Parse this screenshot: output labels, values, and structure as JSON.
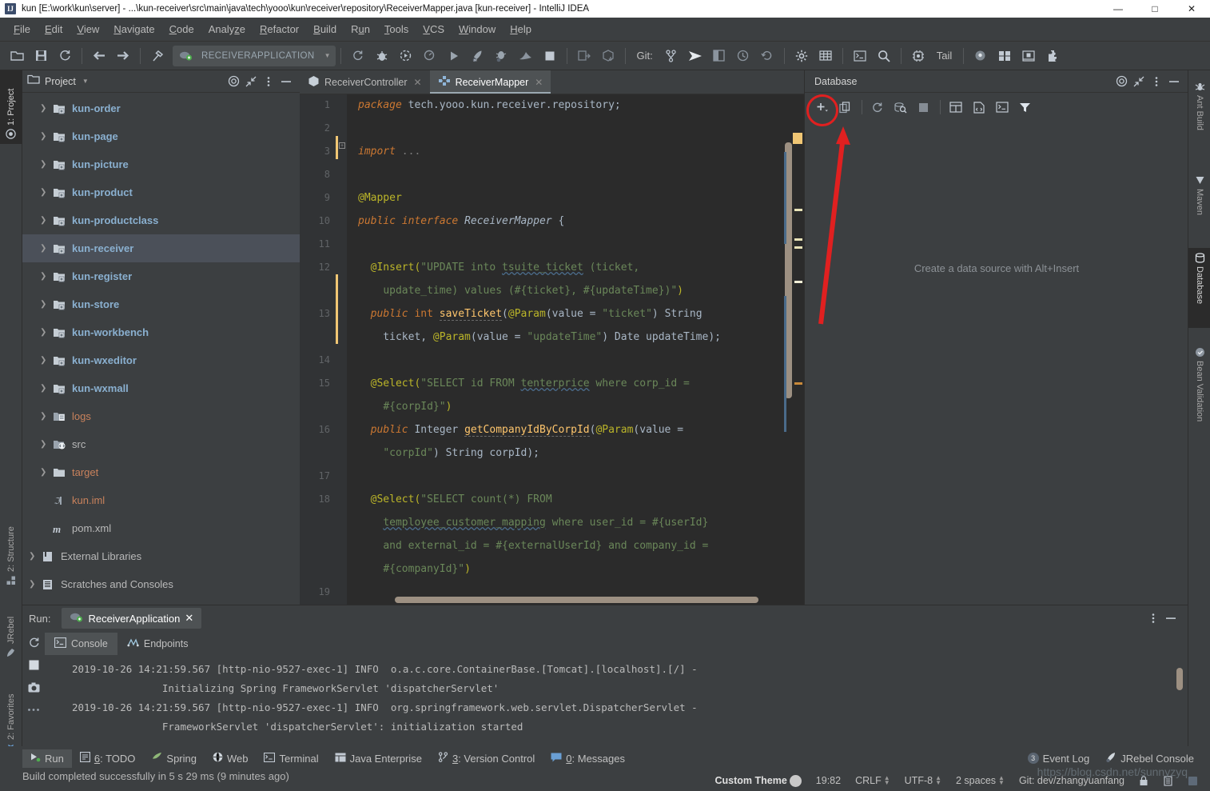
{
  "window": {
    "title": "kun [E:\\work\\kun\\server] - ...\\kun-receiver\\src\\main\\java\\tech\\yooo\\kun\\receiver\\repository\\ReceiverMapper.java [kun-receiver] - IntelliJ IDEA",
    "minimize": "—",
    "maximize": "□",
    "close": "✕"
  },
  "menu": [
    {
      "label": "File"
    },
    {
      "label": "Edit"
    },
    {
      "label": "View"
    },
    {
      "label": "Navigate"
    },
    {
      "label": "Code"
    },
    {
      "label": "Analyze"
    },
    {
      "label": "Refactor"
    },
    {
      "label": "Build"
    },
    {
      "label": "Run"
    },
    {
      "label": "Tools"
    },
    {
      "label": "VCS"
    },
    {
      "label": "Window"
    },
    {
      "label": "Help"
    }
  ],
  "toolbar": {
    "run_configuration": "RECEIVERAPPLICATION",
    "git_label": "Git:",
    "tail_label": "Tail",
    "icons": [
      "open-folder-icon",
      "save-all-icon",
      "sync-icon",
      "back-icon",
      "forward-icon",
      "build-hammer-icon",
      "refresh-icon",
      "debug-icon",
      "run-with-coverage-icon",
      "profiler-icon",
      "run-icon",
      "jrebel-run-icon",
      "jrebel-debug-icon",
      "jrebel-stop-icon",
      "stop-icon",
      "deploy-icon",
      "artifact-icon",
      "git-branch-icon",
      "git-push-icon",
      "git-diff-icon",
      "history-icon",
      "revert-icon",
      "settings-gear-icon",
      "project-structure-icon",
      "terminal-icon",
      "search-everywhere-icon",
      "ide-settings-icon",
      "jrebel-monitor-icon",
      "layout-icon",
      "ui-designer-icon",
      "plugin-icon"
    ]
  },
  "left_strip": [
    {
      "label": "1: Project",
      "icon": "project-icon",
      "active": true
    },
    {
      "label": "2: Structure",
      "icon": "structure-icon",
      "active": false
    },
    {
      "label": "JRebel",
      "icon": "jrebel-icon",
      "active": false
    },
    {
      "label": "2: Favorites",
      "icon": "favorites-star-icon",
      "active": false
    }
  ],
  "right_strip": [
    {
      "label": "Ant Build",
      "icon": "ant-build-icon",
      "active": false
    },
    {
      "label": "Maven",
      "icon": "maven-icon",
      "active": false
    },
    {
      "label": "Database",
      "icon": "database-icon",
      "active": true
    },
    {
      "label": "Bean Validation",
      "icon": "bean-validation-icon",
      "active": false
    }
  ],
  "project_panel": {
    "title": "Project",
    "dropdown_icon": "chevron-down-icon",
    "head_buttons": [
      "locate-target-icon",
      "collapse-all-icon",
      "options-menu-icon",
      "hide-panel-icon"
    ],
    "tree": [
      {
        "label": "kun-order",
        "type": "module",
        "expandable": true,
        "selected": false
      },
      {
        "label": "kun-page",
        "type": "module",
        "expandable": true,
        "selected": false
      },
      {
        "label": "kun-picture",
        "type": "module",
        "expandable": true,
        "selected": false
      },
      {
        "label": "kun-product",
        "type": "module",
        "expandable": true,
        "selected": false
      },
      {
        "label": "kun-productclass",
        "type": "module",
        "expandable": true,
        "selected": false
      },
      {
        "label": "kun-receiver",
        "type": "module",
        "expandable": true,
        "selected": true
      },
      {
        "label": "kun-register",
        "type": "module",
        "expandable": true,
        "selected": false
      },
      {
        "label": "kun-store",
        "type": "module",
        "expandable": true,
        "selected": false
      },
      {
        "label": "kun-workbench",
        "type": "module",
        "expandable": true,
        "selected": false
      },
      {
        "label": "kun-wxeditor",
        "type": "module",
        "expandable": true,
        "selected": false
      },
      {
        "label": "kun-wxmall",
        "type": "module",
        "expandable": true,
        "selected": false
      },
      {
        "label": "logs",
        "type": "orange",
        "expandable": true,
        "selected": false
      },
      {
        "label": "src",
        "type": "plain",
        "expandable": true,
        "selected": false
      },
      {
        "label": "target",
        "type": "orange",
        "expandable": true,
        "selected": false
      },
      {
        "label": "kun.iml",
        "type": "orange",
        "expandable": false,
        "selected": false
      },
      {
        "label": "pom.xml",
        "type": "plain",
        "expandable": false,
        "selected": false
      },
      {
        "label": "External Libraries",
        "type": "plain",
        "expandable": true,
        "selected": false,
        "root": true
      },
      {
        "label": "Scratches and Consoles",
        "type": "plain",
        "expandable": true,
        "selected": false,
        "root": true
      }
    ]
  },
  "editor": {
    "tabs": [
      {
        "label": "ReceiverController",
        "icon": "java-class-icon",
        "active": false,
        "close": "✕"
      },
      {
        "label": "ReceiverMapper",
        "icon": "mapper-icon",
        "active": true,
        "close": "✕"
      }
    ],
    "line_numbers": [
      "1",
      "2",
      "3",
      "8",
      "9",
      "10",
      "11",
      "12",
      "13",
      "14",
      "15",
      "16",
      "17",
      "18",
      "19"
    ],
    "code_lines": [
      "package tech.yooo.kun.receiver.repository;",
      "",
      "import ...",
      "",
      "@Mapper",
      "public interface ReceiverMapper {",
      "",
      "  @Insert(\"UPDATE into tsuite_ticket (ticket,",
      "    update_time) values (#{ticket}, #{updateTime})\")",
      "  public int saveTicket(@Param(value = \"ticket\") String",
      "    ticket, @Param(value = \"updateTime\") Date updateTime);",
      "",
      "  @Select(\"SELECT id FROM tenterprice where corp_id =",
      "    #{corpId}\")",
      "  public Integer getCompanyIdByCorpId(@Param(value =",
      "    \"corpId\") String corpId);",
      "",
      "  @Select(\"SELECT count(*) FROM",
      "    temployee_customer_mapping where user_id = #{userId}",
      "    and external_id = #{externalUserId} and company_id =",
      "    #{companyId}\")"
    ]
  },
  "database_panel": {
    "title": "Database",
    "head_buttons": [
      "locate-target-icon",
      "collapse-all-icon",
      "options-menu-icon",
      "hide-panel-icon"
    ],
    "toolbar_buttons": [
      "add-data-source-icon",
      "duplicate-icon",
      "refresh-icon",
      "find-in-db-icon",
      "stop-icon",
      "table-editor-icon",
      "ddl-file-icon",
      "console-icon",
      "filter-icon"
    ],
    "empty_text": "Create a data source with Alt+Insert",
    "annotation_color": "#e02020"
  },
  "run_panel": {
    "run_label": "Run:",
    "tab_label": "ReceiverApplication",
    "tab_close": "✕",
    "sub_tabs": [
      {
        "label": "Console",
        "icon": "console-icon",
        "active": true
      },
      {
        "label": "Endpoints",
        "icon": "endpoints-icon",
        "active": false
      }
    ],
    "side_buttons": [
      "rerun-icon",
      "stop-icon",
      "camera-icon",
      "more-icon",
      "more2-icon"
    ],
    "head_buttons": [
      "options-menu-icon",
      "hide-panel-icon"
    ],
    "console_lines": [
      "2019-10-26 14:21:59.567 [http-nio-9527-exec-1] INFO  o.a.c.core.ContainerBase.[Tomcat].[localhost].[/] -",
      "               Initializing Spring FrameworkServlet 'dispatcherServlet'",
      "2019-10-26 14:21:59.567 [http-nio-9527-exec-1] INFO  org.springframework.web.servlet.DispatcherServlet -",
      "               FrameworkServlet 'dispatcherServlet': initialization started"
    ]
  },
  "status_bar": {
    "tools": [
      {
        "label": "Run",
        "icon": "run-icon",
        "active": true,
        "mnemonic": ""
      },
      {
        "label": "6: TODO",
        "icon": "todo-icon",
        "active": false,
        "mnemonic": "6"
      },
      {
        "label": "Spring",
        "icon": "spring-icon",
        "active": false,
        "mnemonic": ""
      },
      {
        "label": "Web",
        "icon": "web-icon",
        "active": false,
        "mnemonic": ""
      },
      {
        "label": "Terminal",
        "icon": "terminal-icon",
        "active": false,
        "mnemonic": ""
      },
      {
        "label": "Java Enterprise",
        "icon": "javaee-icon",
        "active": false,
        "mnemonic": ""
      },
      {
        "label": "3: Version Control",
        "icon": "vcs-icon",
        "active": false,
        "mnemonic": "3"
      },
      {
        "label": "0: Messages",
        "icon": "messages-icon",
        "active": false,
        "mnemonic": "0"
      }
    ],
    "right_tools": [
      {
        "label": "Event Log",
        "icon": "event-log-icon",
        "badge": "3"
      },
      {
        "label": "JRebel Console",
        "icon": "jrebel-icon",
        "badge": ""
      }
    ],
    "build_message": "Build completed successfully in 5 s 29 ms (9 minutes ago)",
    "theme_label": "Custom Theme",
    "caret_position": "19:82",
    "line_separator": "CRLF",
    "encoding": "UTF-8",
    "indent": "2 spaces",
    "git_branch": "Git: dev/zhangyuanfang",
    "watermark": "https://blog.csdn.net/sunnyzyq"
  }
}
